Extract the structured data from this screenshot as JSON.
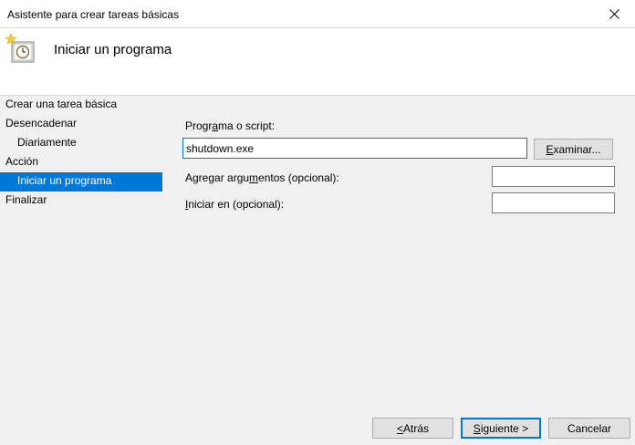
{
  "window": {
    "title": "Asistente para crear tareas básicas"
  },
  "header": {
    "title": "Iniciar un programa",
    "icon": "task-clock-icon"
  },
  "steps": [
    {
      "label": "Crear una tarea básica"
    },
    {
      "label": "Desencadenar"
    },
    {
      "label": "Diariamente"
    },
    {
      "label": "Acción"
    },
    {
      "label": "Iniciar un programa",
      "selected": true
    },
    {
      "label": "Finalizar"
    }
  ],
  "form": {
    "program": {
      "label_pre": "Progr",
      "label_key": "a",
      "label_post": "ma o script:",
      "value": "shutdown.exe"
    },
    "browse_button": {
      "label_key": "E",
      "label_post": "xaminar..."
    },
    "arguments": {
      "label_pre": "Agregar argu",
      "label_key": "m",
      "label_post": "entos (opcional):",
      "value": ""
    },
    "start_in": {
      "label_key": "I",
      "label_post": "niciar en (opcional):",
      "value": ""
    }
  },
  "buttons": {
    "back_key": "<",
    "back_rest": " Atrás",
    "next_key": "S",
    "next_rest": "iguiente >",
    "cancel": "Cancelar"
  },
  "colors": {
    "selection": "#0078d7",
    "panel": "#f0f0f0"
  }
}
